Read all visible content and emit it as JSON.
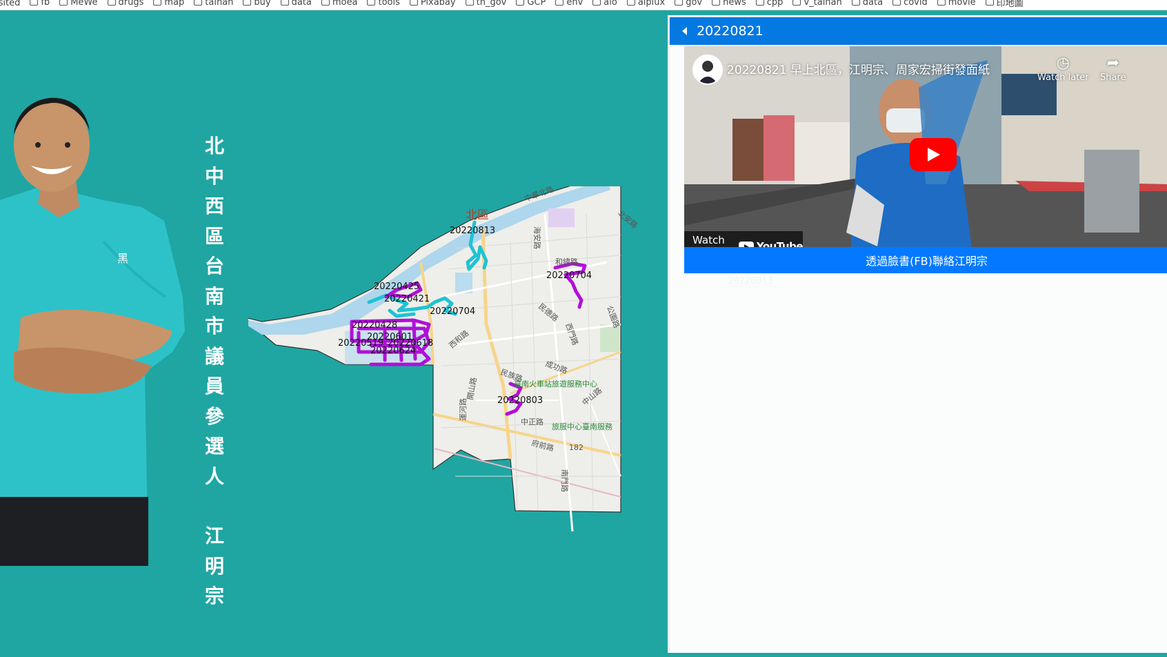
{
  "bookmarks": [
    {
      "label": "isited",
      "icon": "none"
    },
    {
      "label": "fb",
      "icon": "folder-icon"
    },
    {
      "label": "MeWe",
      "icon": "mewe-icon"
    },
    {
      "label": "drugs",
      "icon": "folder-icon"
    },
    {
      "label": "map",
      "icon": "folder-icon"
    },
    {
      "label": "tainan",
      "icon": "folder-icon"
    },
    {
      "label": "buy",
      "icon": "folder-icon"
    },
    {
      "label": "data",
      "icon": "folder-icon"
    },
    {
      "label": "moea",
      "icon": "folder-icon"
    },
    {
      "label": "tools",
      "icon": "folder-icon"
    },
    {
      "label": "Pixabay",
      "icon": "pixabay-icon"
    },
    {
      "label": "tn_gov",
      "icon": "folder-icon"
    },
    {
      "label": "GCP",
      "icon": "gcp-icon"
    },
    {
      "label": "env",
      "icon": "folder-icon"
    },
    {
      "label": "aio",
      "icon": "folder-icon"
    },
    {
      "label": "aiplux",
      "icon": "folder-icon"
    },
    {
      "label": "gov",
      "icon": "folder-icon"
    },
    {
      "label": "news",
      "icon": "folder-icon"
    },
    {
      "label": "cpp",
      "icon": "folder-icon"
    },
    {
      "label": "v_tainan",
      "icon": "folder-icon"
    },
    {
      "label": "data",
      "icon": "folder-icon"
    },
    {
      "label": "covid",
      "icon": "folder-icon"
    },
    {
      "label": "movie",
      "icon": "folder-icon"
    },
    {
      "label": "印地圖",
      "icon": "map-pin-icon"
    }
  ],
  "title_chars": [
    "北",
    "中",
    "西",
    "區",
    "台",
    "南",
    "市",
    "議",
    "員",
    "參",
    "選",
    "人"
  ],
  "name_chars": [
    "江",
    "明",
    "宗"
  ],
  "map": {
    "district_label": "北區",
    "routes": [
      {
        "label": "20220813",
        "color": "#1ec3d3"
      },
      {
        "label": "20220425",
        "color": "#b010d8"
      },
      {
        "label": "20220421",
        "color": "#1ec3d3"
      },
      {
        "label": "20220704",
        "color": "#1ec3d3"
      },
      {
        "label": "20220428",
        "color": "#b010d8"
      },
      {
        "label": "20220601",
        "color": "#b010d8"
      },
      {
        "label": "20220519",
        "color": "#b010d8"
      },
      {
        "label": "20220618",
        "color": "#b010d8"
      },
      {
        "label": "20220624",
        "color": "#b010d8"
      },
      {
        "label": "20220704",
        "color": "#b010d8"
      },
      {
        "label": "20220803",
        "color": "#b010d8"
      }
    ],
    "streets": [
      "中華北路",
      "北安路",
      "海安路",
      "和緯路",
      "民德路",
      "西門路",
      "公園路",
      "成功路",
      "民族路",
      "西和路",
      "開山路",
      "臺南火車站旅遊服務中心",
      "旅服中心臺南服務",
      "中山路",
      "中正路",
      "府前路",
      "182",
      "南門路",
      "運河路"
    ]
  },
  "panel": {
    "header_title": "20220821",
    "video_title": "20220821 早上北區，江明宗、周家宏掃街發面紙",
    "watch_later": "Watch later",
    "share": "Share",
    "watch_on": "Watch on",
    "youtube": "YouTube",
    "fb_button": "透過臉書(FB)聯絡江明宗",
    "ghost_label": "20220813"
  },
  "colors": {
    "background": "#1fa6a2",
    "header_blue": "#0479e1",
    "fb_blue": "#0479ff",
    "route_cyan": "#1ec3d3",
    "route_magenta": "#b010d8"
  }
}
